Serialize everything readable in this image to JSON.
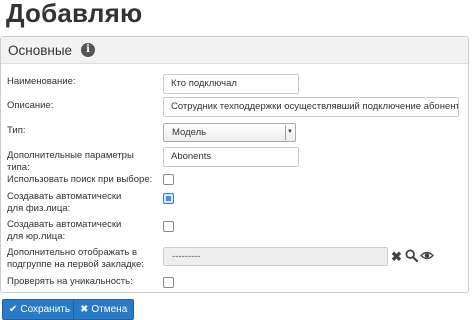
{
  "page": {
    "title": "Добавляю"
  },
  "panel": {
    "title": "Основные"
  },
  "fields": {
    "name": {
      "label": "Наименование:",
      "value": "Кто подключал"
    },
    "description": {
      "label": "Описание:",
      "value": "Сотрудник техподдержки осуществлявший подключение абонента"
    },
    "type": {
      "label": "Тип:",
      "value": "Модель"
    },
    "type_params": {
      "label": "Дополнительные параметры типа:",
      "value": "Abonents"
    },
    "use_search": {
      "label": "Использовать поиск при выборе:",
      "checked": false
    },
    "auto_create_phys": {
      "label": "Создавать автоматически для физ.лица:",
      "checked": true
    },
    "auto_create_jur": {
      "label": "Создавать автоматически для юр.лица:",
      "checked": false
    },
    "show_subgroup": {
      "label": "Дополнительно отображать в подгруппе на первой закладке:",
      "value": "---------"
    },
    "check_unique": {
      "label": "Проверять на уникальность:",
      "checked": false
    }
  },
  "buttons": {
    "save": "Сохранить",
    "cancel": "Отмена"
  },
  "icons": {
    "info": "info-icon",
    "clear": "close-icon",
    "search": "search-icon",
    "view": "eye-icon"
  },
  "colors": {
    "primary": "#2a7ac6",
    "panel_header": "#f2f2f2",
    "checkbox_checked": "#4a90e2"
  }
}
